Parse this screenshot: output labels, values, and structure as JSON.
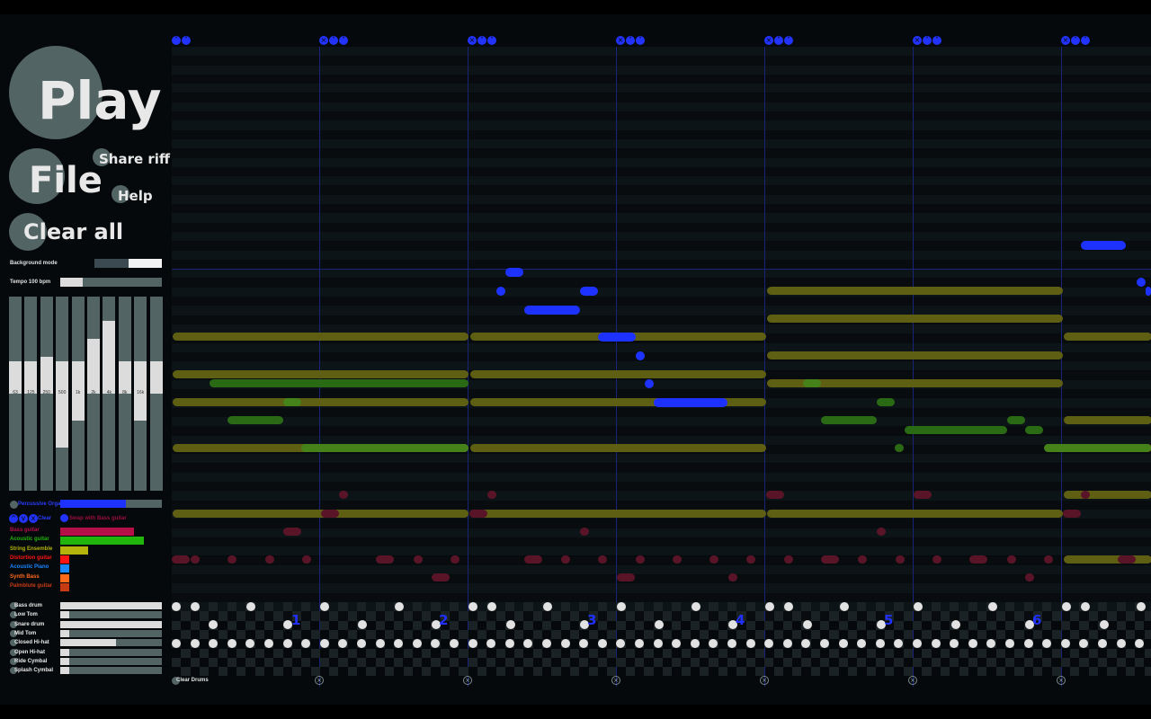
{
  "controls": {
    "play_label": "Play",
    "file_label": "File",
    "share_label": "Share riff",
    "help_label": "Help",
    "clear_all_label": "Clear all",
    "background_mode_label": "Background mode",
    "tempo_label": "Tempo 100 bpm",
    "tempo_value_bpm": 100
  },
  "equalizer": {
    "bands": [
      "63",
      "125",
      "250",
      "500",
      "1k",
      "2k",
      "4k",
      "8k",
      "16k"
    ],
    "levels": [
      0.0,
      0.0,
      0.05,
      -0.6,
      -0.3,
      0.25,
      0.45,
      0.0,
      -0.3,
      0.0
    ]
  },
  "instruments": {
    "active": "Percussive Organ",
    "active_level": 0.65,
    "controls_label": "Clear",
    "swap_label": "Swap with Bass guitar",
    "list": [
      {
        "name": "Bass guitar",
        "color": "#b40f46",
        "level": 0.73
      },
      {
        "name": "Acoustic guitar",
        "color": "#21b40c",
        "level": 0.82
      },
      {
        "name": "String Ensemble",
        "color": "#b4b40c",
        "level": 0.27
      },
      {
        "name": "Distortion guitar",
        "color": "#ff1414",
        "level": 0.09
      },
      {
        "name": "Acoustic Piano",
        "color": "#1a87ff",
        "level": 0.09
      },
      {
        "name": "Synth Bass",
        "color": "#ff6a1a",
        "level": 0.09
      },
      {
        "name": "Palmblute guitar",
        "color": "#c83c14",
        "level": 0.09
      }
    ]
  },
  "drums": {
    "clear_label": "Clear Drums",
    "tracks": [
      {
        "name": "Bass drum",
        "level": 1.0
      },
      {
        "name": "Low Tom",
        "level": 0.09
      },
      {
        "name": "Snare drum",
        "level": 1.0
      },
      {
        "name": "Mid Tom",
        "level": 0.09
      },
      {
        "name": "Closed Hi-hat",
        "level": 0.55
      },
      {
        "name": "Open Hi-hat",
        "level": 0.09
      },
      {
        "name": "Ride Cymbal",
        "level": 0.09
      },
      {
        "name": "Splash Cymbal",
        "level": 0.09
      }
    ]
  },
  "bars": {
    "numbers": [
      "1",
      "2",
      "3",
      "4",
      "5",
      "6"
    ],
    "first_controls": "^v",
    "controls": "x^v"
  },
  "colors": {
    "background": "#06090b",
    "button": "#536464",
    "accent_blue": "#1e32ff",
    "olive": "#5f5f14",
    "green": "#2a6a14",
    "maroon": "#5a1428"
  }
}
